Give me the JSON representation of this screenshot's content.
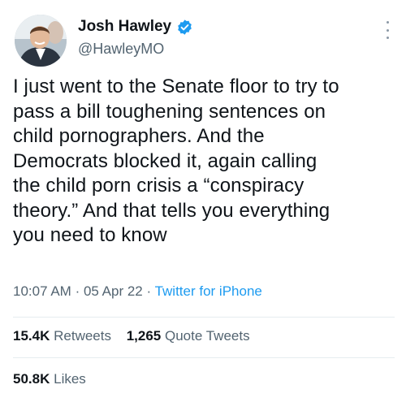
{
  "author": {
    "display_name": "Josh Hawley",
    "handle": "@HawleyMO",
    "verified_color": "#1d9bf0"
  },
  "tweet": {
    "lines": [
      "I just went to the Senate floor to try to",
      "pass a bill toughening sentences on",
      "child pornographers. And the",
      "Democrats blocked it, again calling",
      "the child porn crisis a “conspiracy",
      "theory.” And that tells you everything",
      "you need to know"
    ]
  },
  "meta": {
    "time": "10:07 AM",
    "separator": "·",
    "date": "05 Apr 22",
    "source": "Twitter for iPhone"
  },
  "stats": {
    "retweets_count": "15.4K",
    "retweets_label": "Retweets",
    "quotes_count": "1,265",
    "quotes_label": "Quote Tweets",
    "likes_count": "50.8K",
    "likes_label": "Likes"
  }
}
